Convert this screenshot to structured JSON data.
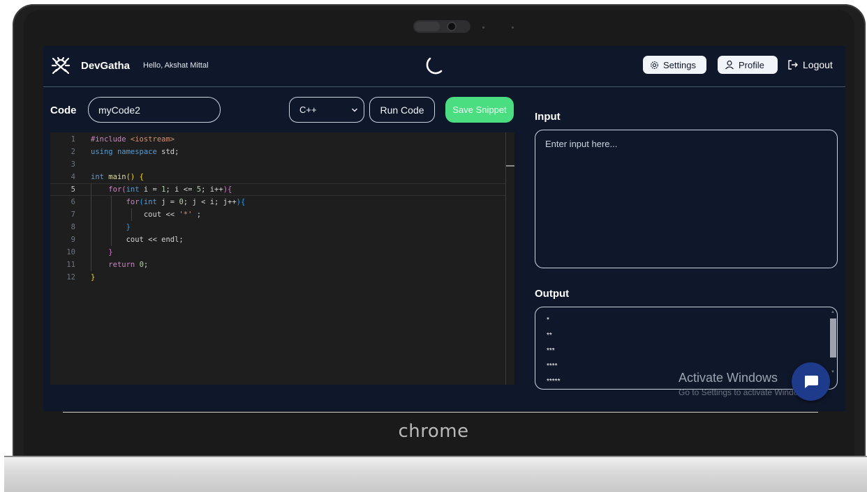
{
  "brand": {
    "name": "DevGatha",
    "greeting": "Hello, Akshat Mittal"
  },
  "nav": {
    "settings_label": "Settings",
    "profile_label": "Profile",
    "logout_label": "Logout"
  },
  "editor_panel": {
    "code_label": "Code",
    "snippet_name": "myCode2",
    "language": "C++",
    "run_label": "Run Code",
    "save_label": "Save Snippet"
  },
  "code": {
    "line_numbers": [
      "1",
      "2",
      "3",
      "4",
      "5",
      "6",
      "7",
      "8",
      "9",
      "10",
      "11",
      "12"
    ],
    "active_line": 5
  },
  "io": {
    "input_label": "Input",
    "input_placeholder": "Enter input here...",
    "output_label": "Output",
    "output_lines": [
      "*",
      "**",
      "***",
      "****",
      "*****"
    ]
  },
  "watermark": {
    "title": "Activate Windows",
    "subtitle": "Go to Settings to activate Windows."
  },
  "device": {
    "brand": "chrome"
  },
  "colors": {
    "background": "#0f172a",
    "save_button": "#4ade80",
    "chat_button": "#1e3a8a"
  }
}
